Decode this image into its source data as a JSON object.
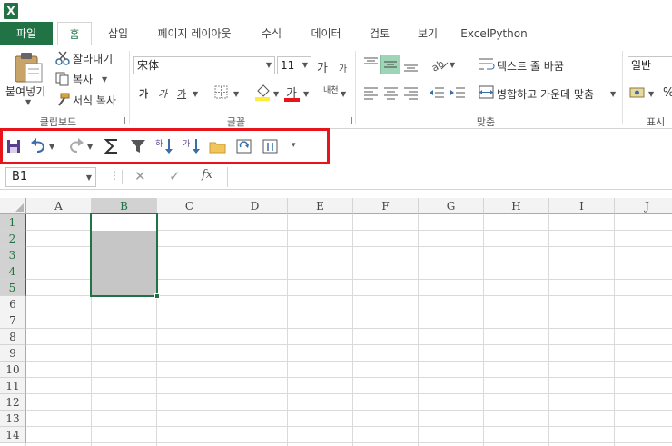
{
  "app": {
    "logo": "X"
  },
  "tabs": [
    {
      "label": "파일"
    },
    {
      "label": "홈"
    },
    {
      "label": "삽입"
    },
    {
      "label": "페이지 레이아웃"
    },
    {
      "label": "수식"
    },
    {
      "label": "데이터"
    },
    {
      "label": "검토"
    },
    {
      "label": "보기"
    },
    {
      "label": "ExcelPython"
    }
  ],
  "clipboard": {
    "paste": "붙여넣기",
    "cut": "잘라내기",
    "copy": "복사",
    "format_painter": "서식 복사",
    "group": "클립보드"
  },
  "font": {
    "name": "宋体",
    "size": "11",
    "grow": "가",
    "shrink": "가",
    "bold": "가",
    "italic": "가",
    "underline": "가",
    "font_color": "가",
    "phonetic": "내천",
    "group": "글꼴"
  },
  "alignment": {
    "wrap_text": "텍스트 줄 바꿈",
    "merge_center": "병합하고 가운데 맞춤",
    "group": "맞춤"
  },
  "number": {
    "format": "일반",
    "percent": "%",
    "group": "표시"
  },
  "formula_bar": {
    "name_box": "B1",
    "fx": "fx",
    "cancel": "✕",
    "enter": "✓"
  },
  "grid": {
    "columns": [
      "A",
      "B",
      "C",
      "D",
      "E",
      "F",
      "G",
      "H",
      "I",
      "J"
    ],
    "rows": [
      "1",
      "2",
      "3",
      "4",
      "5",
      "6",
      "7",
      "8",
      "9",
      "10",
      "11",
      "12",
      "13",
      "14"
    ]
  },
  "colors": {
    "accent": "#217346",
    "highlight_border": "#e8141c"
  }
}
